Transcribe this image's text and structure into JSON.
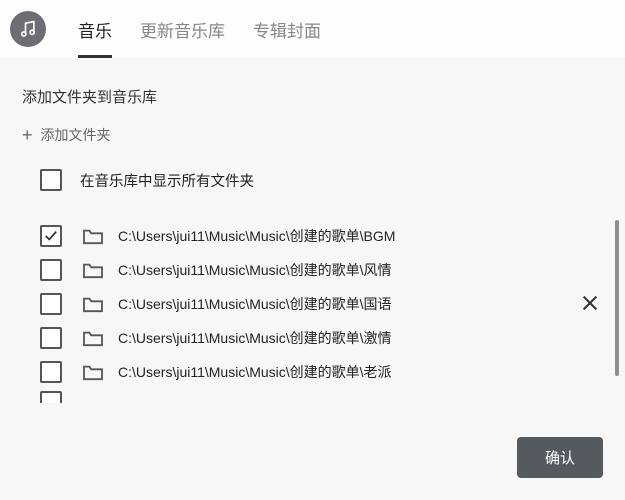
{
  "header": {
    "tabs": [
      {
        "label": "音乐",
        "active": true
      },
      {
        "label": "更新音乐库",
        "active": false
      },
      {
        "label": "专辑封面",
        "active": false
      }
    ]
  },
  "section_title": "添加文件夹到音乐库",
  "add_folder_label": "添加文件夹",
  "show_all": {
    "label": "在音乐库中显示所有文件夹",
    "checked": false
  },
  "folders": [
    {
      "path": "C:\\Users\\jui11\\Music\\Music\\创建的歌单\\BGM",
      "checked": true
    },
    {
      "path": "C:\\Users\\jui11\\Music\\Music\\创建的歌单\\风情",
      "checked": false
    },
    {
      "path": "C:\\Users\\jui11\\Music\\Music\\创建的歌单\\国语",
      "checked": false
    },
    {
      "path": "C:\\Users\\jui11\\Music\\Music\\创建的歌单\\激情",
      "checked": false
    },
    {
      "path": "C:\\Users\\jui11\\Music\\Music\\创建的歌单\\老派",
      "checked": false
    }
  ],
  "confirm_label": "确认"
}
